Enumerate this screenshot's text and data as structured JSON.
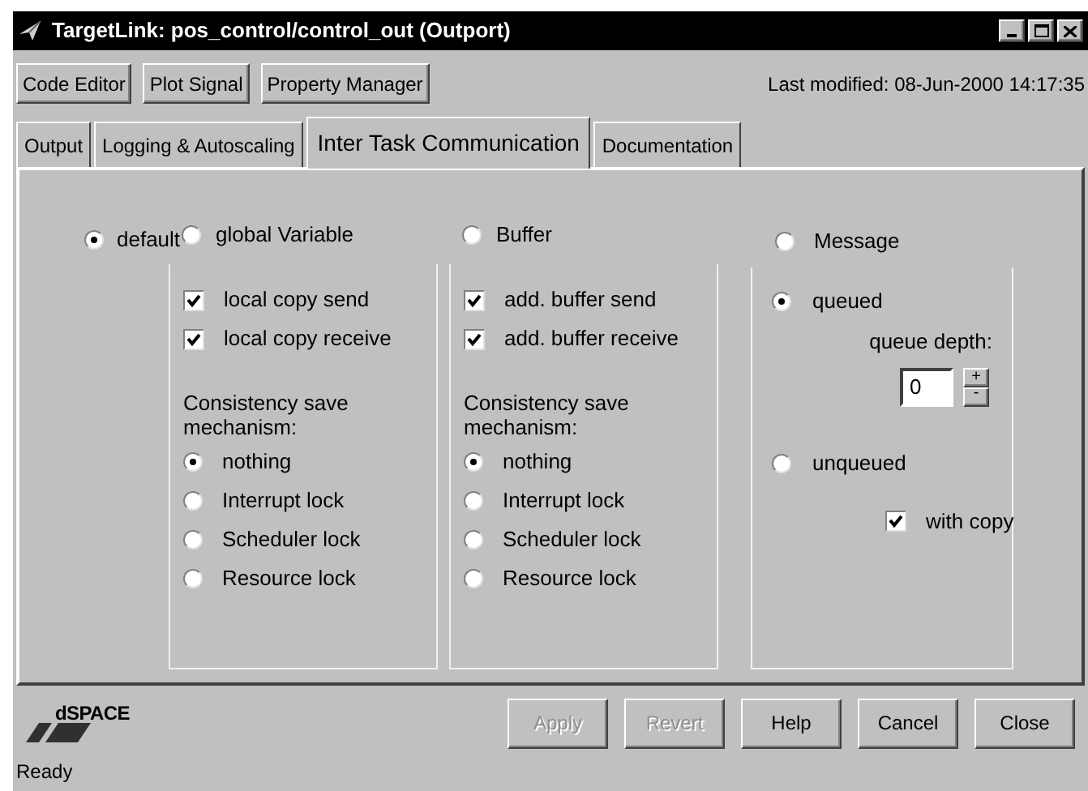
{
  "window": {
    "title": "TargetLink: pos_control/control_out  (Outport)"
  },
  "toolbar": {
    "buttons": [
      "Code Editor",
      "Plot Signal",
      "Property Manager"
    ],
    "last_modified": "Last modified: 08-Jun-2000 14:17:35"
  },
  "tabs": [
    {
      "label": "Output",
      "selected": false
    },
    {
      "label": "Logging & Autoscaling",
      "selected": false
    },
    {
      "label": "Inter Task Communication",
      "selected": true
    },
    {
      "label": "Documentation",
      "selected": false
    }
  ],
  "modes": [
    {
      "kind": "plain",
      "label": "default",
      "selected": true
    },
    {
      "kind": "copies",
      "label": "global Variable",
      "selected": false,
      "checkboxes": [
        {
          "label": "local copy send",
          "checked": true
        },
        {
          "label": "local copy receive",
          "checked": true
        }
      ],
      "consistency_label": "Consistency save mechanism:",
      "locks": [
        {
          "label": "nothing",
          "selected": true
        },
        {
          "label": "Interrupt lock",
          "selected": false
        },
        {
          "label": "Scheduler lock",
          "selected": false
        },
        {
          "label": "Resource lock",
          "selected": false
        }
      ]
    },
    {
      "kind": "copies",
      "label": "Buffer",
      "selected": false,
      "checkboxes": [
        {
          "label": "add. buffer send",
          "checked": true
        },
        {
          "label": "add. buffer receive",
          "checked": true
        }
      ],
      "consistency_label": "Consistency save mechanism:",
      "locks": [
        {
          "label": "nothing",
          "selected": true
        },
        {
          "label": "Interrupt lock",
          "selected": false
        },
        {
          "label": "Scheduler lock",
          "selected": false
        },
        {
          "label": "Resource lock",
          "selected": false
        }
      ]
    },
    {
      "kind": "message",
      "label": "Message",
      "selected": false,
      "queued": {
        "label": "queued",
        "selected": true
      },
      "queue_depth_label": "queue depth:",
      "queue_depth": "0",
      "spin_up": "+",
      "spin_down": "-",
      "unqueued": {
        "label": "unqueued",
        "selected": false
      },
      "with_copy": {
        "label": "with copy",
        "checked": true
      }
    }
  ],
  "footer": {
    "logo": "dSPACE",
    "buttons": [
      {
        "label": "Apply",
        "disabled": true
      },
      {
        "label": "Revert",
        "disabled": true
      },
      {
        "label": "Help",
        "disabled": false
      },
      {
        "label": "Cancel",
        "disabled": false
      },
      {
        "label": "Close",
        "disabled": false
      }
    ],
    "status": "Ready"
  }
}
